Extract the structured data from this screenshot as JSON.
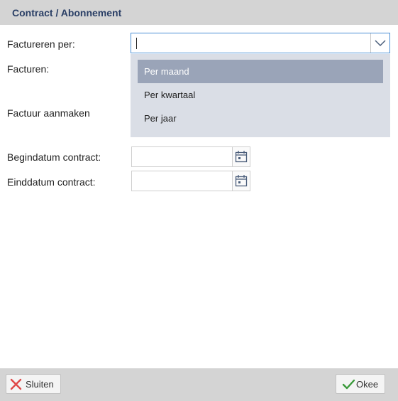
{
  "dialog": {
    "title": "Contract / Abonnement"
  },
  "form": {
    "factureren_per_label": "Factureren per:",
    "factureren_per_value": "",
    "facturen_label": "Facturen:",
    "factuur_aanmaken_label": "Factuur aanmaken",
    "begindatum_label": "Begindatum contract:",
    "begindatum_value": "",
    "einddatum_label": "Einddatum contract:",
    "einddatum_value": ""
  },
  "dropdown": {
    "options": [
      "Per maand",
      "Per kwartaal",
      "Per jaar"
    ],
    "highlighted": "Per maand"
  },
  "footer": {
    "close_label": "Sluiten",
    "ok_label": "Okee"
  },
  "colors": {
    "title": "#2a3f66",
    "focus_border": "#4a8ed4",
    "dropdown_bg": "#dadee6",
    "highlight_bg": "#9aa4b8",
    "close_icon": "#e04848",
    "ok_icon": "#3a9a3a"
  },
  "icons": {
    "select_arrow": "chevron-down-icon",
    "date_picker": "calendar-icon",
    "close": "close-icon",
    "ok": "checkmark-icon"
  }
}
